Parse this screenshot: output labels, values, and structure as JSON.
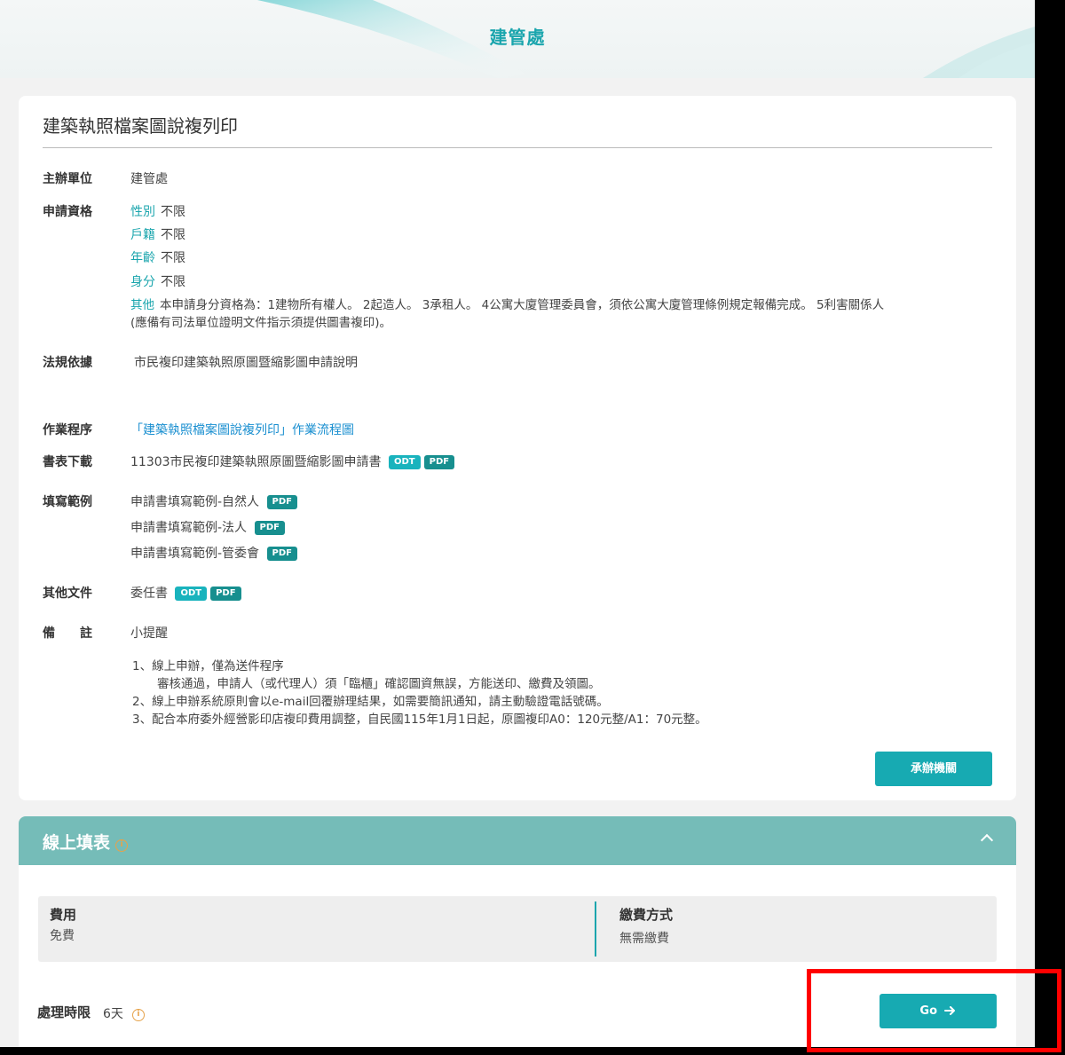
{
  "header": {
    "title": "建管處"
  },
  "service": {
    "title": "建築執照檔案圖說複列印",
    "organizer": {
      "label": "主辦單位",
      "value": "建管處"
    },
    "eligibility": {
      "label": "申請資格",
      "items": [
        {
          "key": "性別",
          "value": "不限"
        },
        {
          "key": "戶籍",
          "value": "不限"
        },
        {
          "key": "年齡",
          "value": "不限"
        },
        {
          "key": "身分",
          "value": "不限"
        },
        {
          "key": "其他",
          "value": "本申請身分資格為：1建物所有權人。 2起造人。 3承租人。 4公寓大廈管理委員會，須依公寓大廈管理條例規定報備完成。 5利害關係人",
          "value2": "(應備有司法單位證明文件指示須提供圖書複印)。"
        }
      ]
    },
    "regulation": {
      "label": "法規依據",
      "value": "市民複印建築執照原圖暨縮影圖申請說明"
    },
    "procedure": {
      "label": "作業程序",
      "link": "「建築執照檔案圖說複列印」作業流程圖"
    },
    "forms": {
      "label": "書表下載",
      "name": "11303市民複印建築執照原圖暨縮影圖申請書",
      "badge1": "ODT",
      "badge2": "PDF"
    },
    "examples": {
      "label": "填寫範例",
      "items": [
        {
          "name": "申請書填寫範例-自然人",
          "badge": "PDF"
        },
        {
          "name": "申請書填寫範例-法人",
          "badge": "PDF"
        },
        {
          "name": "申請書填寫範例-管委會",
          "badge": "PDF"
        }
      ]
    },
    "other_docs": {
      "label": "其他文件",
      "name": "委任書",
      "badge1": "ODT",
      "badge2": "PDF"
    },
    "notes": {
      "label": "備　　註",
      "heading": "小提醒",
      "lines": [
        "1、線上申辦，僅為送件程序",
        "審核通過，申請人（或代理人）須「臨櫃」確認圖資無誤，方能送印、繳費及領圖。",
        "2、線上申辦系統原則會以e-mail回覆辦理結果，如需要簡訊通知，請主動驗證電話號碼。",
        "3、配合本府委外經營影印店複印費用調整，自民國115年1月1日起，原圖複印A0：120元整/A1：70元整。"
      ]
    },
    "agency_button": "承辦機關"
  },
  "online_form": {
    "title": "線上填表",
    "info_icon": "i",
    "fee": {
      "label": "費用",
      "value": "免費"
    },
    "payment": {
      "label": "繳費方式",
      "value": "無需繳費"
    },
    "time_limit": {
      "label": "處理時限",
      "value": "6天"
    },
    "go_button": "Go"
  },
  "colors": {
    "accent": "#1aa5ad",
    "panel": "#75bcb8",
    "highlight": "#ff0000"
  }
}
